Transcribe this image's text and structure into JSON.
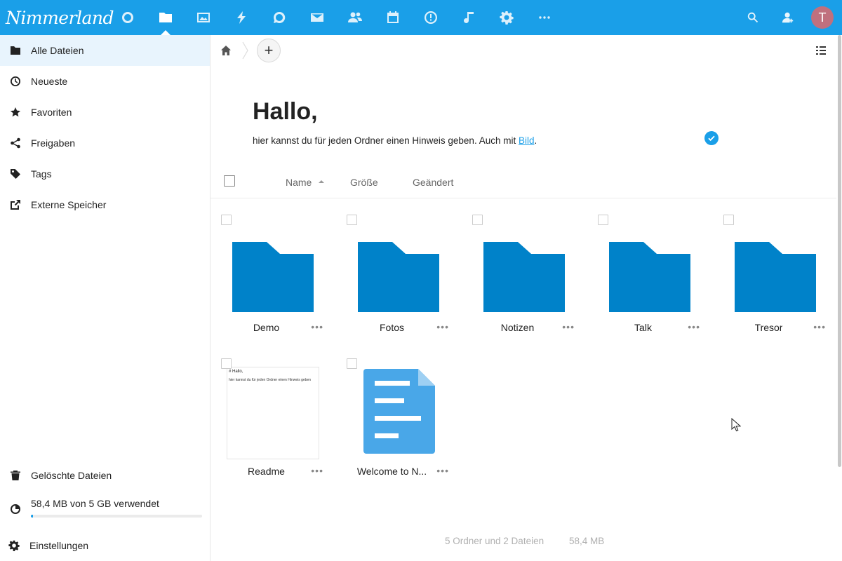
{
  "header": {
    "logo_text": "Nimmerland",
    "apps": [
      {
        "name": "dashboard",
        "icon": "circle-icon"
      },
      {
        "name": "files",
        "icon": "folder-icon",
        "active": true
      },
      {
        "name": "photos",
        "icon": "image-icon"
      },
      {
        "name": "activity",
        "icon": "lightning-icon"
      },
      {
        "name": "talk",
        "icon": "chat-bubble-icon"
      },
      {
        "name": "mail",
        "icon": "envelope-icon"
      },
      {
        "name": "contacts",
        "icon": "contacts-icon"
      },
      {
        "name": "calendar",
        "icon": "calendar-icon"
      },
      {
        "name": "deck",
        "icon": "clock-info-icon"
      },
      {
        "name": "music",
        "icon": "music-note-icon"
      },
      {
        "name": "settings",
        "icon": "gear-icon"
      },
      {
        "name": "more",
        "icon": "more-icon"
      }
    ],
    "avatar_initial": "T",
    "avatar_color": "#c0707e",
    "accent_color": "#1a9fe8"
  },
  "sidebar": {
    "items": [
      {
        "label": "Alle Dateien",
        "icon": "folder-icon",
        "active": true
      },
      {
        "label": "Neueste",
        "icon": "clock-icon"
      },
      {
        "label": "Favoriten",
        "icon": "star-icon"
      },
      {
        "label": "Freigaben",
        "icon": "share-icon"
      },
      {
        "label": "Tags",
        "icon": "tag-icon"
      },
      {
        "label": "Externe Speicher",
        "icon": "external-link-icon"
      }
    ],
    "trash_label": "Gelöschte Dateien",
    "quota_text": "58,4 MB von 5 GB verwendet",
    "quota_fraction": 0.012,
    "settings_label": "Einstellungen"
  },
  "readme": {
    "title": "Hallo,",
    "text_before_link": "hier kannst du für jeden Ordner einen Hinweis geben. Auch mit ",
    "link_text": "Bild",
    "text_after_link": "."
  },
  "table_header": {
    "name": "Name",
    "size": "Größe",
    "modified": "Geändert"
  },
  "files": [
    {
      "name": "Demo",
      "type": "folder"
    },
    {
      "name": "Fotos",
      "type": "folder"
    },
    {
      "name": "Notizen",
      "type": "folder"
    },
    {
      "name": "Talk",
      "type": "folder"
    },
    {
      "name": "Tresor",
      "type": "folder"
    },
    {
      "name": "Readme",
      "type": "text",
      "preview_line1": "# Hallo,",
      "preview_line2": "hier kannst du für jeden Ordner einen Hinweis geben"
    },
    {
      "name": "Welcome to N...",
      "type": "document"
    }
  ],
  "summary": {
    "counts": "5 Ordner und 2 Dateien",
    "total_size": "58,4 MB"
  },
  "more_symbol": "•••",
  "add_symbol": "+"
}
